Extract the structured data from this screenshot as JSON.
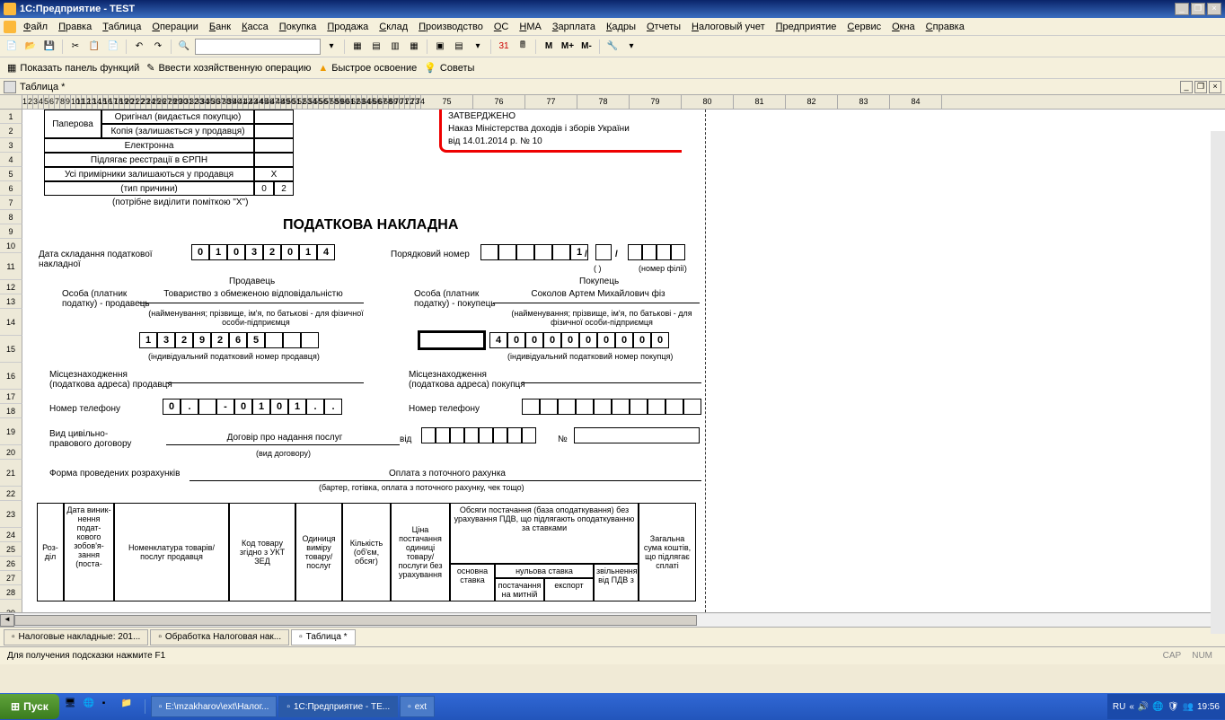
{
  "window": {
    "title": "1С:Предприятие - TEST"
  },
  "menu": [
    "Файл",
    "Правка",
    "Таблица",
    "Операции",
    "Банк",
    "Касса",
    "Покупка",
    "Продажа",
    "Склад",
    "Производство",
    "ОС",
    "НМА",
    "Зарплата",
    "Кадры",
    "Отчеты",
    "Налоговый учет",
    "Предприятие",
    "Сервис",
    "Окна",
    "Справка"
  ],
  "toolbar2": {
    "panel": "Показать панель функций",
    "op": "Ввести хозяйственную операцию",
    "fast": "Быстрое освоение",
    "tips": "Советы"
  },
  "subtitle": "Таблица *",
  "form": {
    "paper": "Паперова",
    "orig": "Оригінал (видається покупцю)",
    "copy": "Копія (залишається у продавця)",
    "electronic": "Електронна",
    "reg": "Підлягає реєстрації в ЄРПН",
    "copies": "Усі примірники залишаються у продавця",
    "reason": "(тип причини)",
    "reasonVal": "0",
    "reasonVal2": "2",
    "mark": "X",
    "note": "(потрібне виділити поміткою \"X\")",
    "approved": "ЗАТВЕРДЖЕНО",
    "order": "Наказ Міністерства доходів і зборів України",
    "date": "від 14.01.2014 р. № 10",
    "title": "ПОДАТКОВА НАКЛАДНА",
    "compDate": "Дата складання податкової накладної",
    "compDateVal": [
      "0",
      "1",
      "0",
      "3",
      "2",
      "0",
      "1",
      "4"
    ],
    "seqNum": "Порядковий номер",
    "seqVal": [
      "",
      "",
      "",
      "",
      "",
      "1"
    ],
    "slash": "/",
    "branch": "(номер філії)",
    "paren": "(  )",
    "seller": "Продавець",
    "buyer": "Покупець",
    "personSeller": "Особа (платник податку) - продавець",
    "personBuyer": "Особа (платник податку) - покупець",
    "sellerName": "Товариство з обмеженою відповідальністю",
    "buyerName": "Соколов Артем Михайлович  фіз",
    "nameNote": "(найменування; прізвище, ім'я, по батькові - для фізичної особи-підприємця",
    "nameNote2": "(найменування; прізвище, ім'я, по батькові - для фізичної особи-підприємця",
    "sellerTax": [
      "1",
      "3",
      "2",
      "9",
      "2",
      "6",
      "5",
      "",
      "",
      ""
    ],
    "buyerTax": [
      "4",
      "0",
      "0",
      "0",
      "0",
      "0",
      "0",
      "0",
      "0",
      "0"
    ],
    "taxNote": "(індивідуальний податковий номер продавця)",
    "taxNoteB": "(індивідуальний податковий номер покупця)",
    "addrS": "Місцезнаходження (податкова адреса) продавця",
    "addrB": "Місцезнаходження (податкова адреса) покупця",
    "phone": "Номер телефону",
    "phoneS": [
      "0",
      ".",
      "",
      "-",
      "0",
      "1",
      "0",
      "1",
      ".",
      "."
    ],
    "contract": "Вид цивільно-правового договору",
    "contractVal": "Договір про надання послуг",
    "contractNote": "(вид договору)",
    "from": "від",
    "num": "№",
    "payment": "Форма проведених розрахунків",
    "paymentVal": "Оплата з поточного рахунка",
    "paymentNote": "(бартер, готівка, оплата з поточного рахунку, чек тощо)",
    "th": {
      "section": "Роз-діл",
      "date": "Дата виник-нення подат-кового зобов'я-зання (поста-",
      "nomen": "Номенклатура товарів/послуг продавця",
      "code": "Код товару згідно з УКТ ЗЕД",
      "unit": "Одиниця виміру товару/послуг",
      "qty": "Кількість (об'єм, обсяг)",
      "price": "Ціна постачання одиниці товару/послуги без урахування",
      "volumes": "Обсяги постачання (база оподаткування) без урахування ПДВ, що підлягають оподаткуванню за ставками",
      "zero": "нульова ставка",
      "main": "основна ставка",
      "customs": "постачання на митній",
      "export": "експорт",
      "exempt": "звільнення від ПДВ з",
      "total": "Загальна сума коштів, що підлягає сплаті"
    }
  },
  "doctabs": [
    "Налоговые накладные: 201...",
    "Обработка  Налоговая нак...",
    "Таблица *"
  ],
  "status": {
    "hint": "Для получения подсказки нажмите F1",
    "cap": "CAP",
    "num": "NUM"
  },
  "taskbar": {
    "start": "Пуск",
    "tasks": [
      "E:\\mzakharov\\ext\\Налог...",
      "1С:Предприятие - TE...",
      "ext"
    ],
    "lang": "RU",
    "time": "19:56"
  }
}
